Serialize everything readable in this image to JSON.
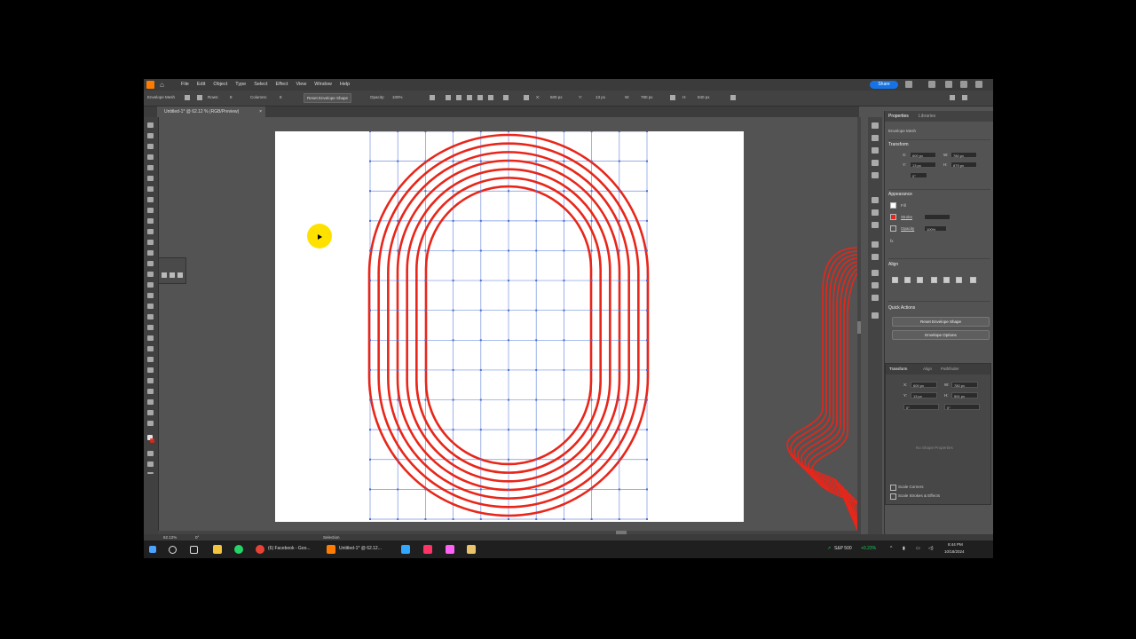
{
  "app": {
    "menus": [
      "File",
      "Edit",
      "Object",
      "Type",
      "Select",
      "Effect",
      "View",
      "Window",
      "Help"
    ],
    "share_label": "Share"
  },
  "control_bar": {
    "mode": "Envelope Mesh",
    "rows_label": "Rows:",
    "rows_value": "8",
    "columns_label": "Columns:",
    "columns_value": "8",
    "reset_label": "Reset Envelope Shape",
    "opacity_label": "Opacity:",
    "opacity_value": "100%",
    "x_value": "600 px",
    "y_value": "13 px",
    "w_value": "780 px",
    "h_value": "840 px"
  },
  "document_tab": {
    "title": "Untitled-1* @ 62.12 % (RGB/Preview)",
    "close": "×"
  },
  "properties_panel": {
    "tabs": [
      "Properties",
      "Libraries"
    ],
    "selection": "Envelope Mesh",
    "transform_heading": "Transform",
    "x": "600 px",
    "y": "13 px",
    "w": "780 px",
    "h": "879 px",
    "angle": "0°",
    "appearance_heading": "Appearance",
    "fill_label": "Fill",
    "stroke_label": "Stroke",
    "opacity_label": "Opacity",
    "opacity_value": "100%",
    "fx_label": "fx",
    "align_heading": "Align",
    "quick_actions_heading": "Quick Actions",
    "reset_button": "Reset Envelope Shape",
    "options_button": "Envelope Options"
  },
  "transform_panel": {
    "tabs": [
      "Transform",
      "Align",
      "Pathfinder"
    ],
    "x": "600 px",
    "y": "13 px",
    "w": "780 px",
    "h": "591 px",
    "angle": "0°",
    "shear": "0°",
    "no_shape": "No Shape Properties",
    "scale_corners": "Scale Corners",
    "scale_strokes": "Scale Strokes & Effects"
  },
  "status_bar": {
    "zoom": "62.12%",
    "angle": "0°",
    "tool": "Selection"
  },
  "taskbar": {
    "facebook_label": "(6) Facebook - Goo...",
    "illustrator_label": "Untitled-1* @ 62.12...",
    "stock_name": "S&P 500",
    "stock_change": "+0.23%",
    "time": "8:44 PM",
    "date": "10/18/2024"
  },
  "colors": {
    "stroke_red": "#e8261a",
    "mesh_blue": "#4a6fd8",
    "share_blue": "#1473e6",
    "cursor_yellow": "#ffe100"
  }
}
